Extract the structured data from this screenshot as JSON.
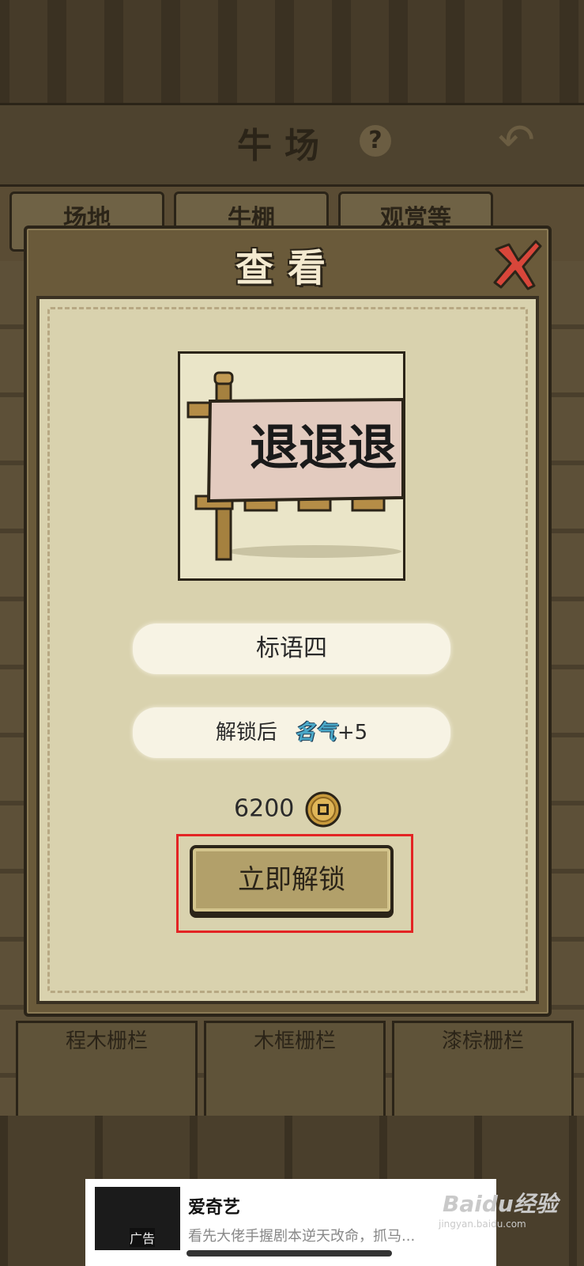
{
  "background": {
    "title": "牛场",
    "help_symbol": "?",
    "back_symbol": "↶",
    "tabs": [
      "场地",
      "牛棚",
      "观赏等"
    ],
    "cards": [
      "程木栅栏",
      "木框栅栏",
      "漆棕栅栏"
    ]
  },
  "dialog": {
    "title": "查看",
    "preview_banner_text": "退退退",
    "item_name": "标语四",
    "reward_prefix": "解锁后",
    "reward_label": "名气",
    "reward_value": "+5",
    "price": "6200",
    "unlock_button": "立即解锁"
  },
  "ad": {
    "title": "爱奇艺",
    "description": "看先大佬手握剧本逆天改命，抓马...",
    "thumb_label": "广告",
    "watermark": "Baidu经验",
    "watermark_sub": "jingyan.baidu.com"
  },
  "colors": {
    "highlight": "#e32424",
    "panel": "#d9d2ae",
    "button": "#b2a06a"
  }
}
